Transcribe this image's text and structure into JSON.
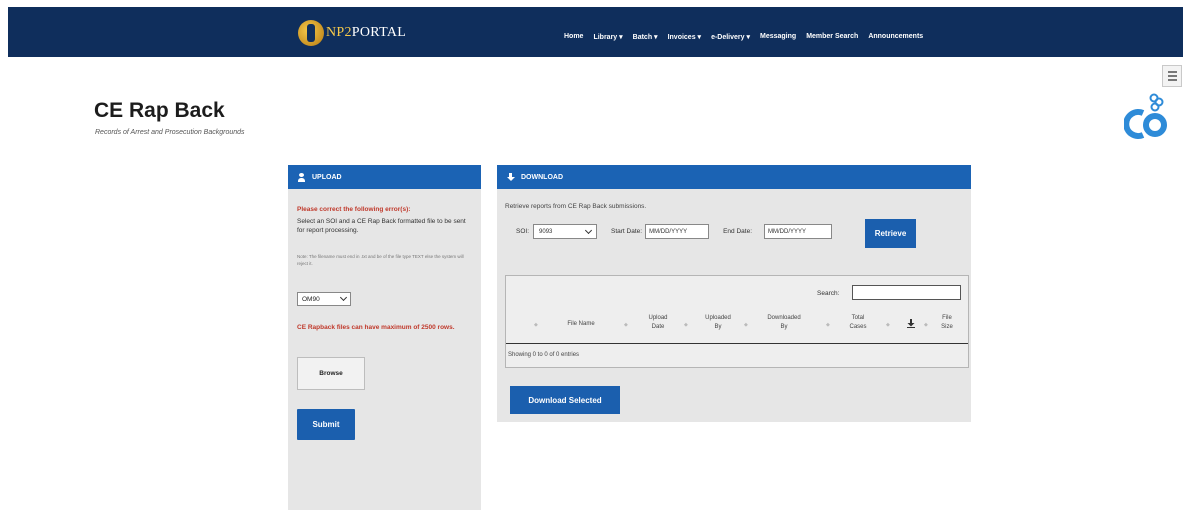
{
  "header": {
    "logo_prefix": "NP2",
    "logo_suffix": "PORTAL",
    "nav": [
      "Home",
      "Library ▾",
      "Batch ▾",
      "Invoices ▾",
      "e-Delivery ▾",
      "Messaging",
      "Member Search",
      "Announcements"
    ]
  },
  "page": {
    "title": "CE Rap Back",
    "subtitle": "Records of Arrest and Prosecution Backgrounds"
  },
  "upload": {
    "header": "UPLOAD",
    "error_title": "Please correct the following error(s):",
    "error_text": "Select an SOI and a CE Rap Back formatted file to be sent for report processing.",
    "note": "Note: The filename must end in .txt and be of the file type TEXT else the system will reject it.",
    "soi_value": "OM90",
    "max_rows_warning": "CE Rapback files can have maximum of 2500 rows.",
    "browse_label": "Browse",
    "submit_label": "Submit"
  },
  "download": {
    "header": "DOWNLOAD",
    "description": "Retrieve reports from CE Rap Back submissions.",
    "soi_label": "SOI:",
    "soi_value": "9093",
    "start_date_label": "Start Date:",
    "start_date_placeholder": "MM/DD/YYYY",
    "end_date_label": "End Date:",
    "end_date_placeholder": "MM/DD/YYYY",
    "retrieve_label": "Retrieve",
    "search_label": "Search:",
    "columns": {
      "file_name": "File Name",
      "upload_date": "Upload Date",
      "uploaded_by": "Uploaded By",
      "downloaded_by": "Downloaded By",
      "total_cases": "Total Cases",
      "file_size": "File Size"
    },
    "info_text": "Showing 0 to 0 of 0 entries",
    "download_selected_label": "Download Selected"
  },
  "colors": {
    "topbar": "#0f2e5c",
    "primary_button": "#1b5fae",
    "panel_header": "#1b63b4",
    "panel_bg": "#e6e6e6",
    "error_red": "#c0392b",
    "ce_logo_blue": "#2e8bd8"
  },
  "icons": {
    "upload_header": "person-upload-icon",
    "download_header": "download-icon",
    "menu": "hamburger-menu-icon",
    "corner_logo": "handcuffs-ce-logo",
    "table_download_column": "download-icon"
  }
}
